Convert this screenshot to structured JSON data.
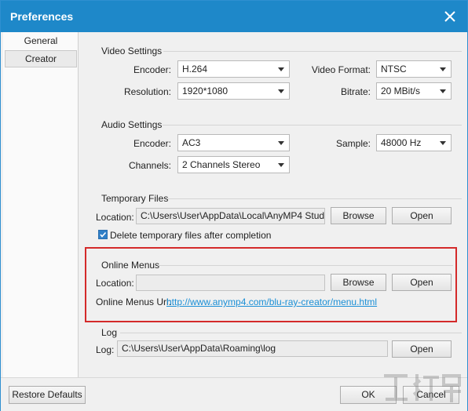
{
  "window": {
    "title": "Preferences"
  },
  "sidebar": {
    "items": [
      {
        "label": "General"
      },
      {
        "label": "Creator"
      }
    ]
  },
  "video": {
    "title": "Video Settings",
    "encoder_label": "Encoder:",
    "encoder_value": "H.264",
    "resolution_label": "Resolution:",
    "resolution_value": "1920*1080",
    "format_label": "Video Format:",
    "format_value": "NTSC",
    "bitrate_label": "Bitrate:",
    "bitrate_value": "20 MBit/s"
  },
  "audio": {
    "title": "Audio Settings",
    "encoder_label": "Encoder:",
    "encoder_value": "AC3",
    "channels_label": "Channels:",
    "channels_value": "2 Channels Stereo",
    "sample_label": "Sample:",
    "sample_value": "48000 Hz"
  },
  "temp": {
    "title": "Temporary Files",
    "location_label": "Location:",
    "location_value": "C:\\Users\\User\\AppData\\Local\\AnyMP4 Studio\\An",
    "browse_label": "Browse",
    "open_label": "Open",
    "delete_label": "Delete temporary files after completion",
    "delete_checked": true
  },
  "online": {
    "title": "Online Menus",
    "location_label": "Location:",
    "location_value": "",
    "browse_label": "Browse",
    "open_label": "Open",
    "url_label": "Online Menus Url:",
    "url_value": "http://www.anymp4.com/blu-ray-creator/menu.html"
  },
  "log": {
    "title": "Log",
    "log_label": "Log:",
    "log_value": "C:\\Users\\User\\AppData\\Roaming\\log",
    "open_label": "Open"
  },
  "footer": {
    "restore_label": "Restore Defaults",
    "ok_label": "OK",
    "cancel_label": "Cancel"
  },
  "colors": {
    "titlebar": "#1e88c9",
    "link": "#1a8fd6",
    "highlight": "#d42a2a"
  }
}
